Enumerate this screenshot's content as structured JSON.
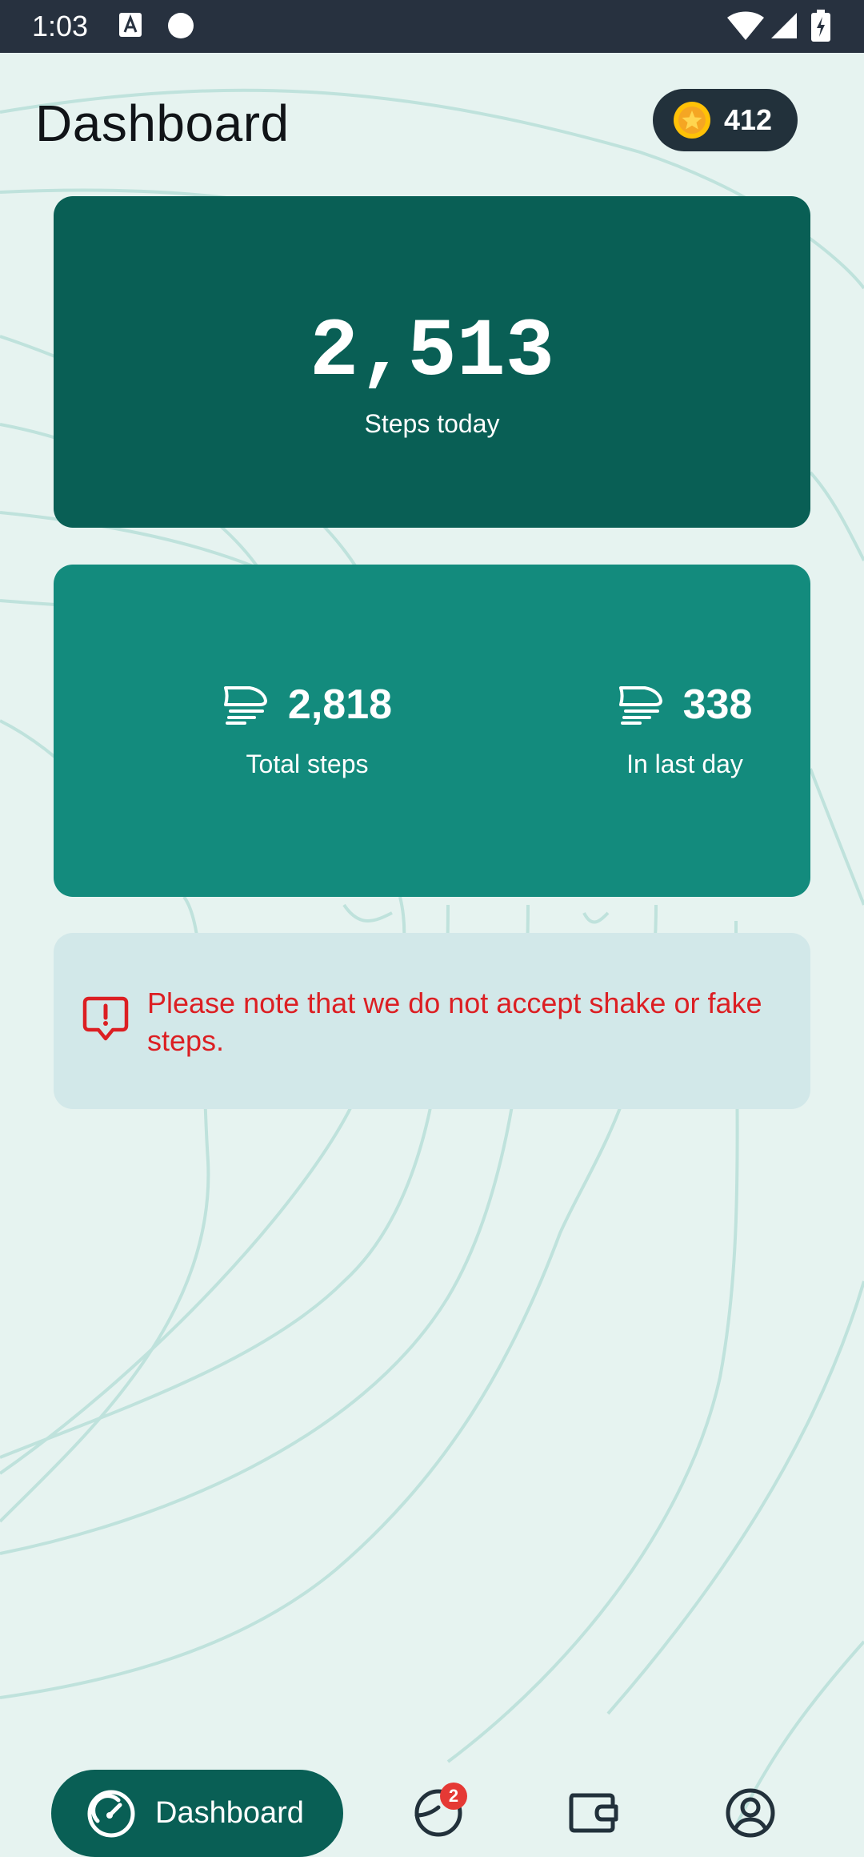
{
  "status_bar": {
    "time": "1:03"
  },
  "header": {
    "title": "Dashboard",
    "coins": "412"
  },
  "today": {
    "steps": "2,513",
    "label": "Steps today"
  },
  "stats": {
    "total": {
      "value": "2,818",
      "label": "Total steps"
    },
    "last_day": {
      "value": "338",
      "label": "In last day"
    }
  },
  "notice": {
    "text": "Please note that we do not accept shake or fake steps."
  },
  "bottom_nav": {
    "active_label": "Dashboard",
    "badge_count": "2"
  },
  "colors": {
    "background": "#e6f3f0",
    "primary_dark": "#095f55",
    "primary": "#138b7d",
    "notice_bg": "#d2e8e9",
    "warning_text": "#dc1f23",
    "status_bar": "#27313f",
    "coin": "#ffc107"
  },
  "icons": {
    "coin": "coin-icon",
    "shoe": "shoe-icon",
    "alert": "alert-bubble-icon",
    "dashboard": "speedometer-icon",
    "stats": "pie-chart-icon",
    "wallet": "wallet-icon",
    "profile": "user-circle-icon"
  }
}
